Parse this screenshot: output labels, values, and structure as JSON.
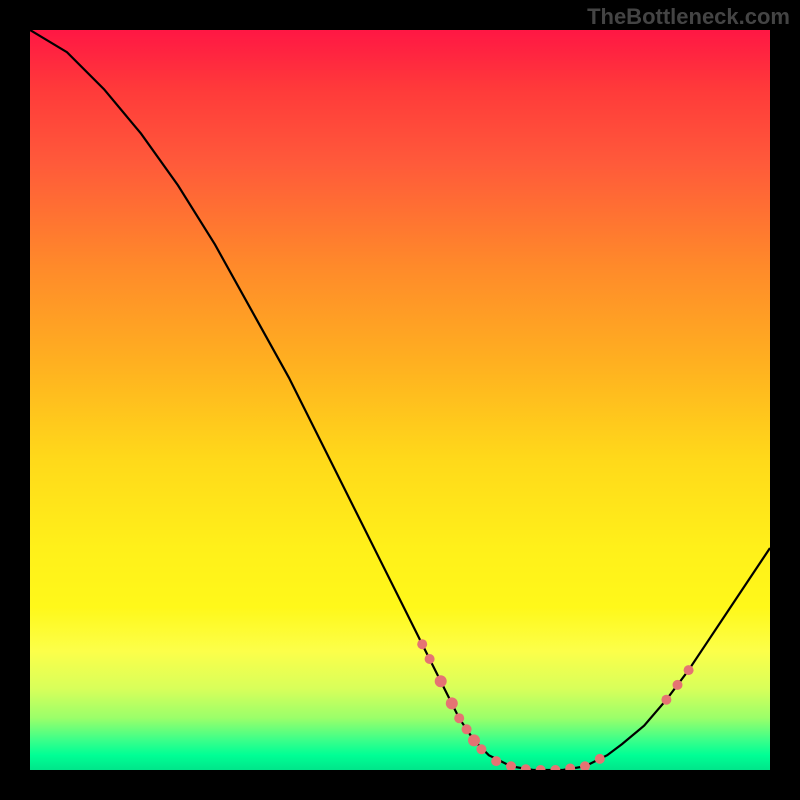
{
  "watermark": "TheBottleneck.com",
  "chart_data": {
    "type": "line",
    "title": "",
    "xlabel": "",
    "ylabel": "",
    "xlim": [
      0,
      100
    ],
    "ylim": [
      0,
      100
    ],
    "curve": {
      "name": "bottleneck-curve",
      "points": [
        [
          0,
          100
        ],
        [
          5,
          97
        ],
        [
          10,
          92
        ],
        [
          15,
          86
        ],
        [
          20,
          79
        ],
        [
          25,
          71
        ],
        [
          30,
          62
        ],
        [
          35,
          53
        ],
        [
          40,
          43
        ],
        [
          45,
          33
        ],
        [
          50,
          23
        ],
        [
          53,
          17
        ],
        [
          56,
          11
        ],
        [
          58,
          7
        ],
        [
          60,
          4
        ],
        [
          62,
          2
        ],
        [
          65,
          0.5
        ],
        [
          68,
          0
        ],
        [
          72,
          0
        ],
        [
          75,
          0.5
        ],
        [
          78,
          2
        ],
        [
          80,
          3.5
        ],
        [
          83,
          6
        ],
        [
          86,
          9.5
        ],
        [
          89,
          13.5
        ],
        [
          92,
          18
        ],
        [
          96,
          24
        ],
        [
          100,
          30
        ]
      ]
    },
    "markers": [
      {
        "x": 53,
        "y": 17,
        "r": 5
      },
      {
        "x": 54,
        "y": 15,
        "r": 5
      },
      {
        "x": 55.5,
        "y": 12,
        "r": 6
      },
      {
        "x": 57,
        "y": 9,
        "r": 6
      },
      {
        "x": 58,
        "y": 7,
        "r": 5
      },
      {
        "x": 59,
        "y": 5.5,
        "r": 5
      },
      {
        "x": 60,
        "y": 4,
        "r": 6
      },
      {
        "x": 61,
        "y": 2.8,
        "r": 5
      },
      {
        "x": 63,
        "y": 1.2,
        "r": 5
      },
      {
        "x": 65,
        "y": 0.5,
        "r": 5
      },
      {
        "x": 67,
        "y": 0.1,
        "r": 5
      },
      {
        "x": 69,
        "y": 0,
        "r": 5
      },
      {
        "x": 71,
        "y": 0,
        "r": 5
      },
      {
        "x": 73,
        "y": 0.2,
        "r": 5
      },
      {
        "x": 75,
        "y": 0.5,
        "r": 5
      },
      {
        "x": 77,
        "y": 1.5,
        "r": 5
      },
      {
        "x": 86,
        "y": 9.5,
        "r": 5
      },
      {
        "x": 87.5,
        "y": 11.5,
        "r": 5
      },
      {
        "x": 89,
        "y": 13.5,
        "r": 5
      }
    ],
    "marker_color": "#e57373",
    "curve_color": "#000000"
  }
}
